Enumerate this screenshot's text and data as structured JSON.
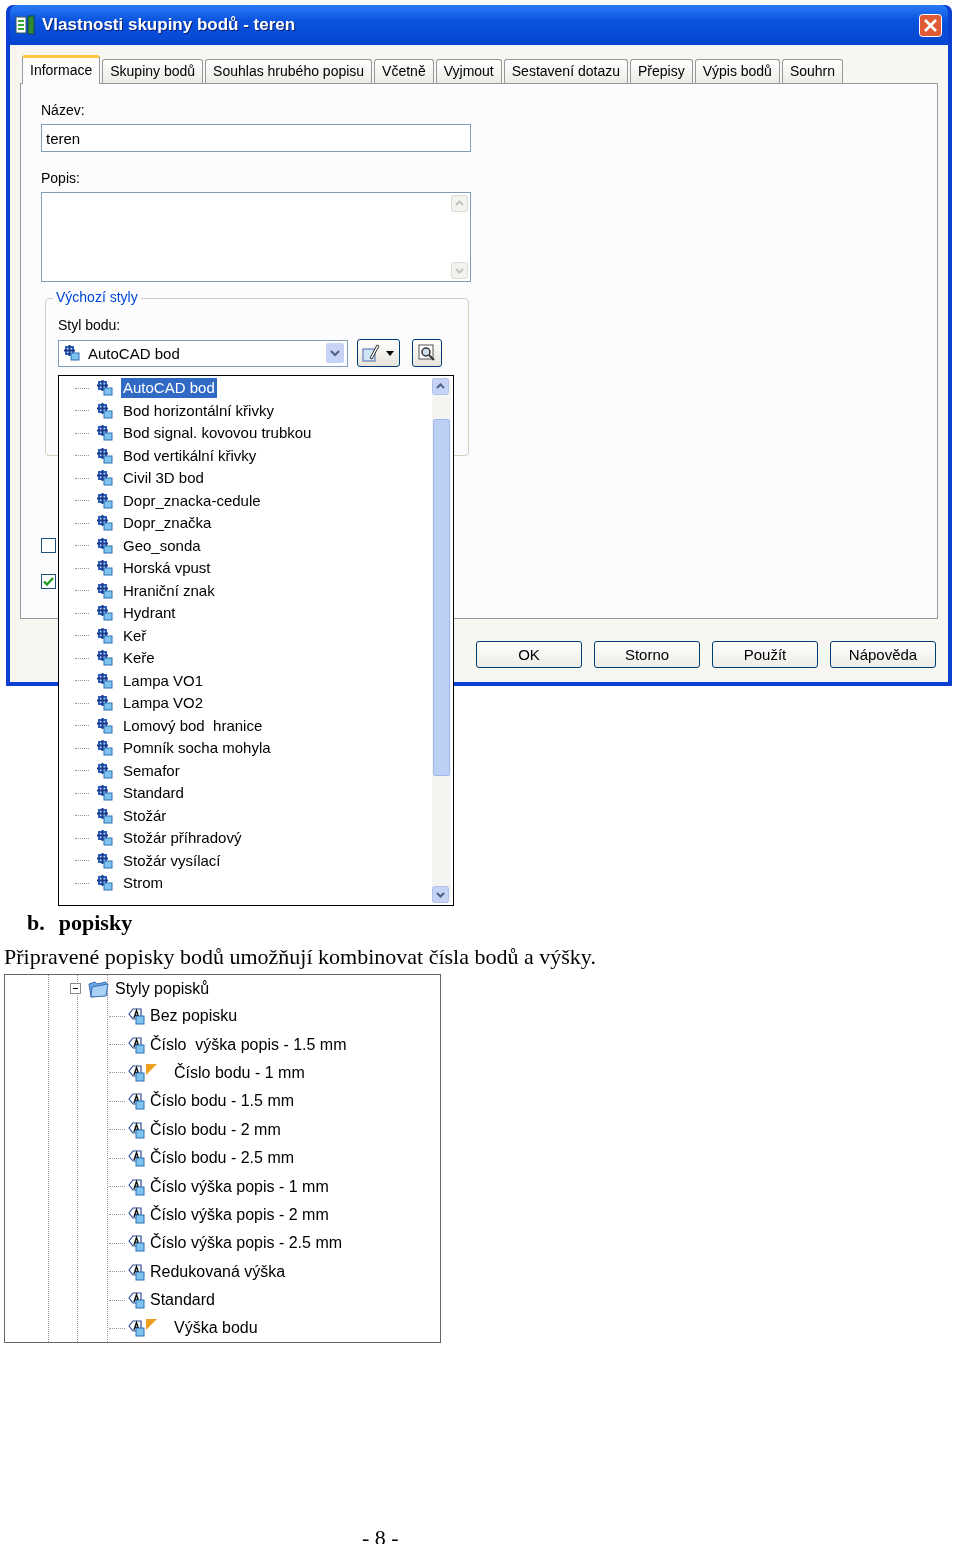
{
  "window": {
    "title": "Vlastnosti skupiny bodů - teren"
  },
  "tabs": [
    {
      "label": "Informace",
      "selected": true
    },
    {
      "label": "Skupiny bodů",
      "selected": false
    },
    {
      "label": "Souhlas hrubého popisu",
      "selected": false
    },
    {
      "label": "Včetně",
      "selected": false
    },
    {
      "label": "Vyjmout",
      "selected": false
    },
    {
      "label": "Sestavení dotazu",
      "selected": false
    },
    {
      "label": "Přepisy",
      "selected": false
    },
    {
      "label": "Výpis bodů",
      "selected": false
    },
    {
      "label": "Souhrn",
      "selected": false
    }
  ],
  "name_field": {
    "label": "Název:",
    "value": "teren"
  },
  "description_field": {
    "label": "Popis:"
  },
  "default_styles": {
    "title": "Výchozí styly",
    "point_style": {
      "label": "Styl bodu:",
      "value": "AutoCAD bod"
    }
  },
  "checkboxes": [
    {
      "checked": false
    },
    {
      "checked": true
    }
  ],
  "dropdown_list": {
    "items": [
      {
        "label": "AutoCAD bod",
        "selected": true
      },
      {
        "label": "Bod horizontální křivky",
        "selected": false
      },
      {
        "label": "Bod signal. kovovou trubkou",
        "selected": false
      },
      {
        "label": "Bod vertikální křivky",
        "selected": false
      },
      {
        "label": "Civil 3D bod",
        "selected": false
      },
      {
        "label": "Dopr_znacka-cedule",
        "selected": false
      },
      {
        "label": "Dopr_značka",
        "selected": false
      },
      {
        "label": "Geo_sonda",
        "selected": false
      },
      {
        "label": "Horská vpust",
        "selected": false
      },
      {
        "label": "Hraniční znak",
        "selected": false
      },
      {
        "label": "Hydrant",
        "selected": false
      },
      {
        "label": "Keř",
        "selected": false
      },
      {
        "label": "Keře",
        "selected": false
      },
      {
        "label": "Lampa VO1",
        "selected": false
      },
      {
        "label": "Lampa VO2",
        "selected": false
      },
      {
        "label": "Lomový bod  hranice",
        "selected": false
      },
      {
        "label": "Pomník socha mohyla",
        "selected": false
      },
      {
        "label": "Semafor",
        "selected": false
      },
      {
        "label": "Standard",
        "selected": false
      },
      {
        "label": "Stožár",
        "selected": false
      },
      {
        "label": "Stožár příhradový",
        "selected": false
      },
      {
        "label": "Stožár vysílací",
        "selected": false
      },
      {
        "label": "Strom",
        "selected": false
      }
    ]
  },
  "buttons": [
    "OK",
    "Storno",
    "Použít",
    "Nápověda"
  ],
  "heading": {
    "number": "b.",
    "title": "popisky"
  },
  "paragraph": "Připravené popisky bodů umožňují kombinovat čísla bodů a výšky.",
  "tree": {
    "label": "Styly popisků",
    "expanded": true,
    "children": [
      {
        "label": "Bez popisku",
        "flagged": false
      },
      {
        "label": "Číslo  výška popis - 1.5 mm",
        "flagged": false
      },
      {
        "label": "Číslo bodu - 1 mm",
        "flagged": true
      },
      {
        "label": "Číslo bodu - 1.5 mm",
        "flagged": false
      },
      {
        "label": "Číslo bodu - 2 mm",
        "flagged": false
      },
      {
        "label": "Číslo bodu - 2.5 mm",
        "flagged": false
      },
      {
        "label": "Číslo výška popis - 1 mm",
        "flagged": false
      },
      {
        "label": "Číslo výška popis - 2 mm",
        "flagged": false
      },
      {
        "label": "Číslo výška popis - 2.5 mm",
        "flagged": false
      },
      {
        "label": "Redukovaná výška",
        "flagged": false
      },
      {
        "label": "Standard",
        "flagged": false
      },
      {
        "label": "Výška bodu",
        "flagged": true
      }
    ]
  },
  "page_number": "- 8 -"
}
